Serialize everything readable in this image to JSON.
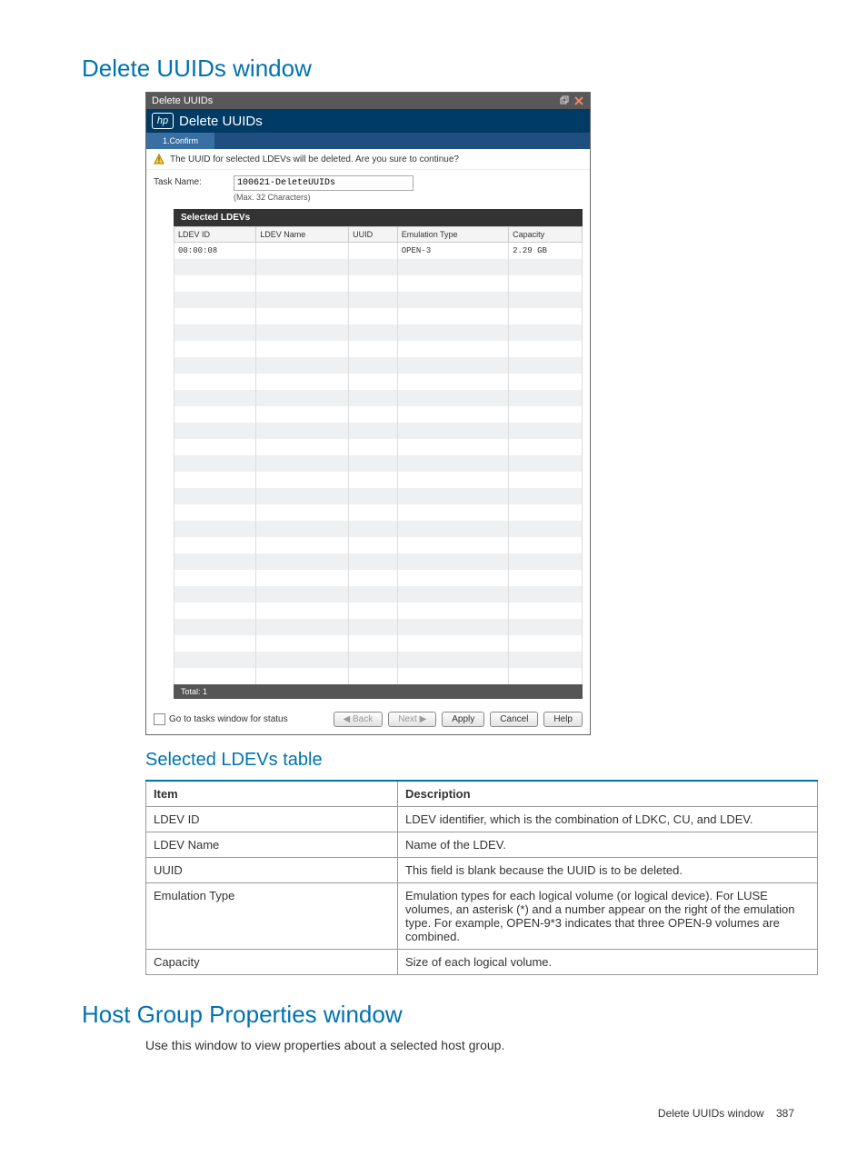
{
  "headings": {
    "h1a": "Delete UUIDs window",
    "h2a": "Selected LDEVs table",
    "h1b": "Host Group Properties window"
  },
  "body_text": {
    "host_group_intro": "Use this window to view properties about a selected host group."
  },
  "window": {
    "titlebar": "Delete UUIDs",
    "heading": "Delete UUIDs",
    "tab1": "1.Confirm",
    "warning": "The UUID for selected LDEVs will be deleted. Are you sure to continue?",
    "task_name_label": "Task Name:",
    "task_name_value": "100621-DeleteUUIDs",
    "task_name_hint": "(Max. 32 Characters)",
    "panel_title": "Selected LDEVs",
    "columns": {
      "ldev_id": "LDEV ID",
      "ldev_name": "LDEV Name",
      "uuid": "UUID",
      "emulation": "Emulation Type",
      "capacity": "Capacity"
    },
    "rows": [
      {
        "ldev_id": "00:00:08",
        "ldev_name": "",
        "uuid": "",
        "emulation": "OPEN-3",
        "capacity": "2.29 GB"
      }
    ],
    "total_label": "Total: 1",
    "go_to_tasks": "Go to tasks window for status",
    "buttons": {
      "back": "◀ Back",
      "next": "Next ▶",
      "apply": "Apply",
      "cancel": "Cancel",
      "help": "Help"
    }
  },
  "desc_table": {
    "head_item": "Item",
    "head_desc": "Description",
    "rows": [
      {
        "item": "LDEV ID",
        "desc": "LDEV identifier, which is the combination of LDKC, CU, and LDEV."
      },
      {
        "item": "LDEV Name",
        "desc": "Name of the LDEV."
      },
      {
        "item": "UUID",
        "desc": "This field is blank because the UUID is to be deleted."
      },
      {
        "item": "Emulation Type",
        "desc": "Emulation types for each logical volume (or logical device). For LUSE volumes, an asterisk (*) and a number appear on the right of the emulation type. For example, OPEN-9*3 indicates that three OPEN-9 volumes are combined."
      },
      {
        "item": "Capacity",
        "desc": "Size of each logical volume."
      }
    ]
  },
  "footer": {
    "text": "Delete UUIDs window",
    "page": "387"
  }
}
